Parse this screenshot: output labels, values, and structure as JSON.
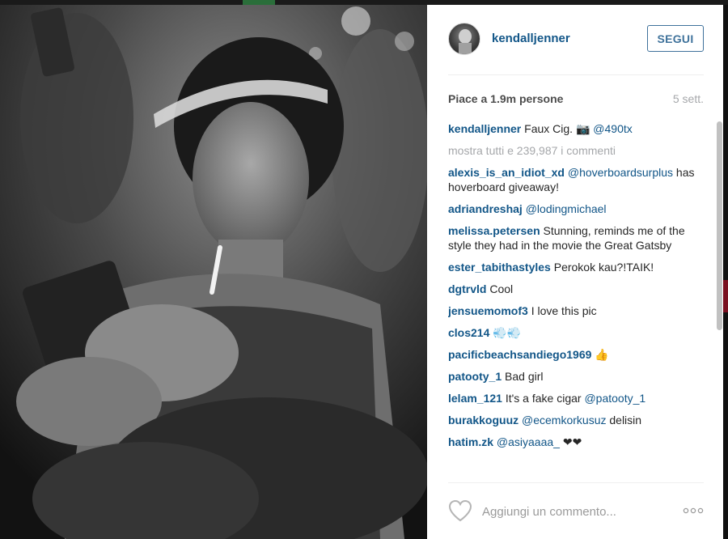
{
  "post": {
    "username": "kendalljenner",
    "follow_label": "SEGUI",
    "likes_text": "Piace a 1.9m persone",
    "time": "5 sett.",
    "caption": {
      "user": "kendalljenner",
      "text": " Faux Cig. 📷 ",
      "mention": "@490tx"
    },
    "view_all_comments": "mostra tutti e 239,987 i commenti",
    "comments": [
      {
        "user": "alexis_is_an_idiot_xd",
        "mention": " @hoverboardsurplus",
        "text": " has hoverboard giveaway!"
      },
      {
        "user": "adriandreshaj",
        "mention": " @lodingmichael",
        "text": ""
      },
      {
        "user": "melissa.petersen",
        "mention": "",
        "text": " Stunning, reminds me of the style they had in the movie the Great Gatsby"
      },
      {
        "user": "ester_tabithastyles",
        "mention": "",
        "text": " Perokok kau?!TAIK!"
      },
      {
        "user": "dgtrvld",
        "mention": "",
        "text": " Cool"
      },
      {
        "user": "jensuemomof3",
        "mention": "",
        "text": " I love this pic"
      },
      {
        "user": "clos214",
        "mention": "",
        "text": " 💨💨"
      },
      {
        "user": "pacificbeachsandiego1969",
        "mention": "",
        "text": " 👍"
      },
      {
        "user": "patooty_1",
        "mention": "",
        "text": " Bad girl"
      },
      {
        "user": "lelam_121",
        "mention": " @patooty_1",
        "text": " It's a fake cigar "
      },
      {
        "user": "burakkoguuz",
        "mention": " @ecemkorkusuz",
        "text": " delisin"
      },
      {
        "user": "hatim.zk",
        "mention": " @asiyaaaa_",
        "text": " ❤❤"
      }
    ],
    "comment_placeholder": "Aggiungi un commento...",
    "icons": {
      "like": "heart-outline-icon",
      "options": "more-options-icon"
    }
  },
  "colors": {
    "username": "#125688",
    "follow_border": "#3f729b",
    "muted": "#a5a7aa"
  }
}
